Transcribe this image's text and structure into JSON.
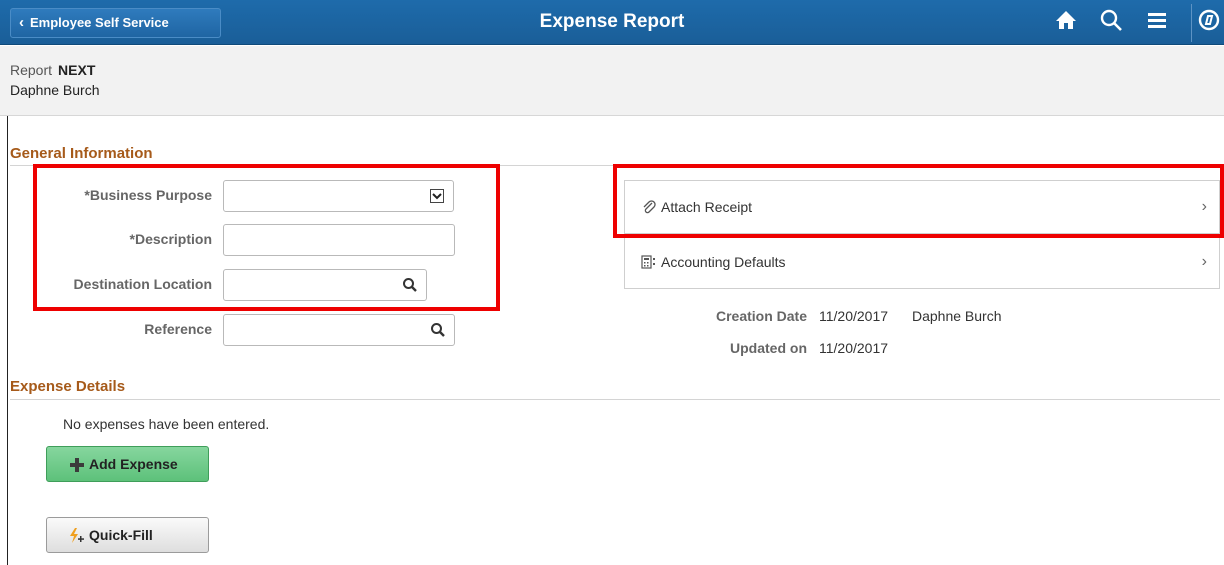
{
  "header": {
    "back_label": "Employee Self Service",
    "title": "Expense Report",
    "icons": [
      "home-icon",
      "search-icon",
      "menu-icon",
      "navbar-icon"
    ]
  },
  "banner": {
    "report_label": "Report",
    "report_value": "NEXT",
    "employee_name": "Daphne Burch"
  },
  "general": {
    "title": "General Information",
    "business_purpose_label": "*Business Purpose",
    "business_purpose_value": "",
    "description_label": "*Description",
    "description_value": "",
    "destination_label": "Destination Location",
    "destination_value": "",
    "reference_label": "Reference",
    "reference_value": ""
  },
  "panel": {
    "attach_receipt": "Attach Receipt",
    "accounting_defaults": "Accounting Defaults"
  },
  "meta": {
    "creation_label": "Creation Date",
    "creation_date": "11/20/2017",
    "creation_by": "Daphne Burch",
    "updated_label": "Updated on",
    "updated_date": "11/20/2017"
  },
  "expense": {
    "title": "Expense Details",
    "empty_message": "No expenses have been entered.",
    "add_button": "Add Expense",
    "quickfill_button": "Quick-Fill"
  },
  "colors": {
    "header_bg": "#1e6bab",
    "section_title": "#a65a1a",
    "highlight": "#e00000",
    "add_button": "#5dc17a"
  }
}
